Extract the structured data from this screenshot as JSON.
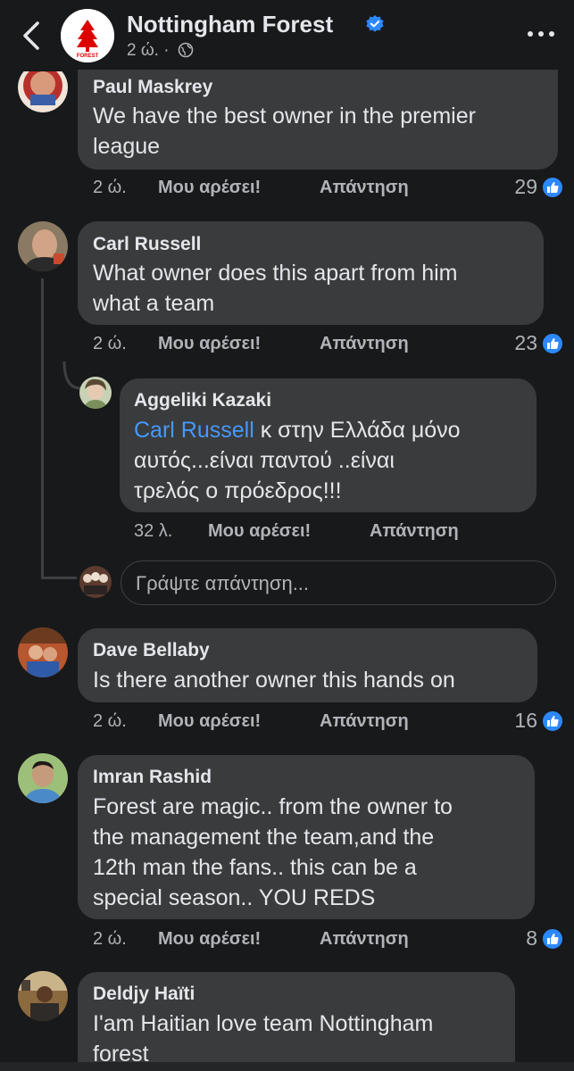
{
  "header": {
    "page_name": "Nottingham Forest",
    "post_age": "2 ώ. · ",
    "logo_text": "FOREST",
    "icons": {
      "back": "chevron-left-icon",
      "verified": "verified-badge-icon",
      "audience": "globe-icon",
      "more": "more-dots-icon"
    }
  },
  "labels": {
    "like": "Μου αρέσει!",
    "reply": "Απάντηση"
  },
  "comments": [
    {
      "name": "Paul Maskrey",
      "lines": [
        "We have the best owner in the premier",
        "league"
      ],
      "time": "2 ώ.",
      "likes": "29"
    },
    {
      "name": "Carl Russell",
      "lines": [
        "What owner does this apart from him",
        "what a team"
      ],
      "time": "2 ώ.",
      "likes": "23"
    },
    {
      "name": "Aggeliki Kazaki",
      "mention": "Carl Russell",
      "lines": [
        " κ στην Ελλάδα  μόνο",
        "αυτός...είναι παντού ..είναι",
        "τρελός ο πρόεδρος!!!"
      ],
      "time": "32 λ."
    },
    {
      "name": "Dave Bellaby",
      "lines": [
        "Is there another owner this hands on"
      ],
      "time": "2 ώ.",
      "likes": "16"
    },
    {
      "name": "Imran Rashid",
      "lines": [
        "Forest are magic.. from the owner to",
        "the management the team,and the",
        "12th man the fans.. this can be a",
        "special season.. YOU REDS"
      ],
      "time": "2 ώ.",
      "likes": "8"
    },
    {
      "name": "Deldjy Haïti",
      "lines": [
        "I'am Haitian love team Nottingham",
        "forest"
      ]
    }
  ],
  "reply_box": {
    "placeholder": "Γράψτε απάντηση..."
  },
  "colors": {
    "background": "#18191a",
    "bubble": "#3a3b3c",
    "text": "#e4e6eb",
    "secondary": "#b0b3b8",
    "accent": "#2d88ff",
    "mention": "#4599ff",
    "brand_red": "#dd0000"
  }
}
